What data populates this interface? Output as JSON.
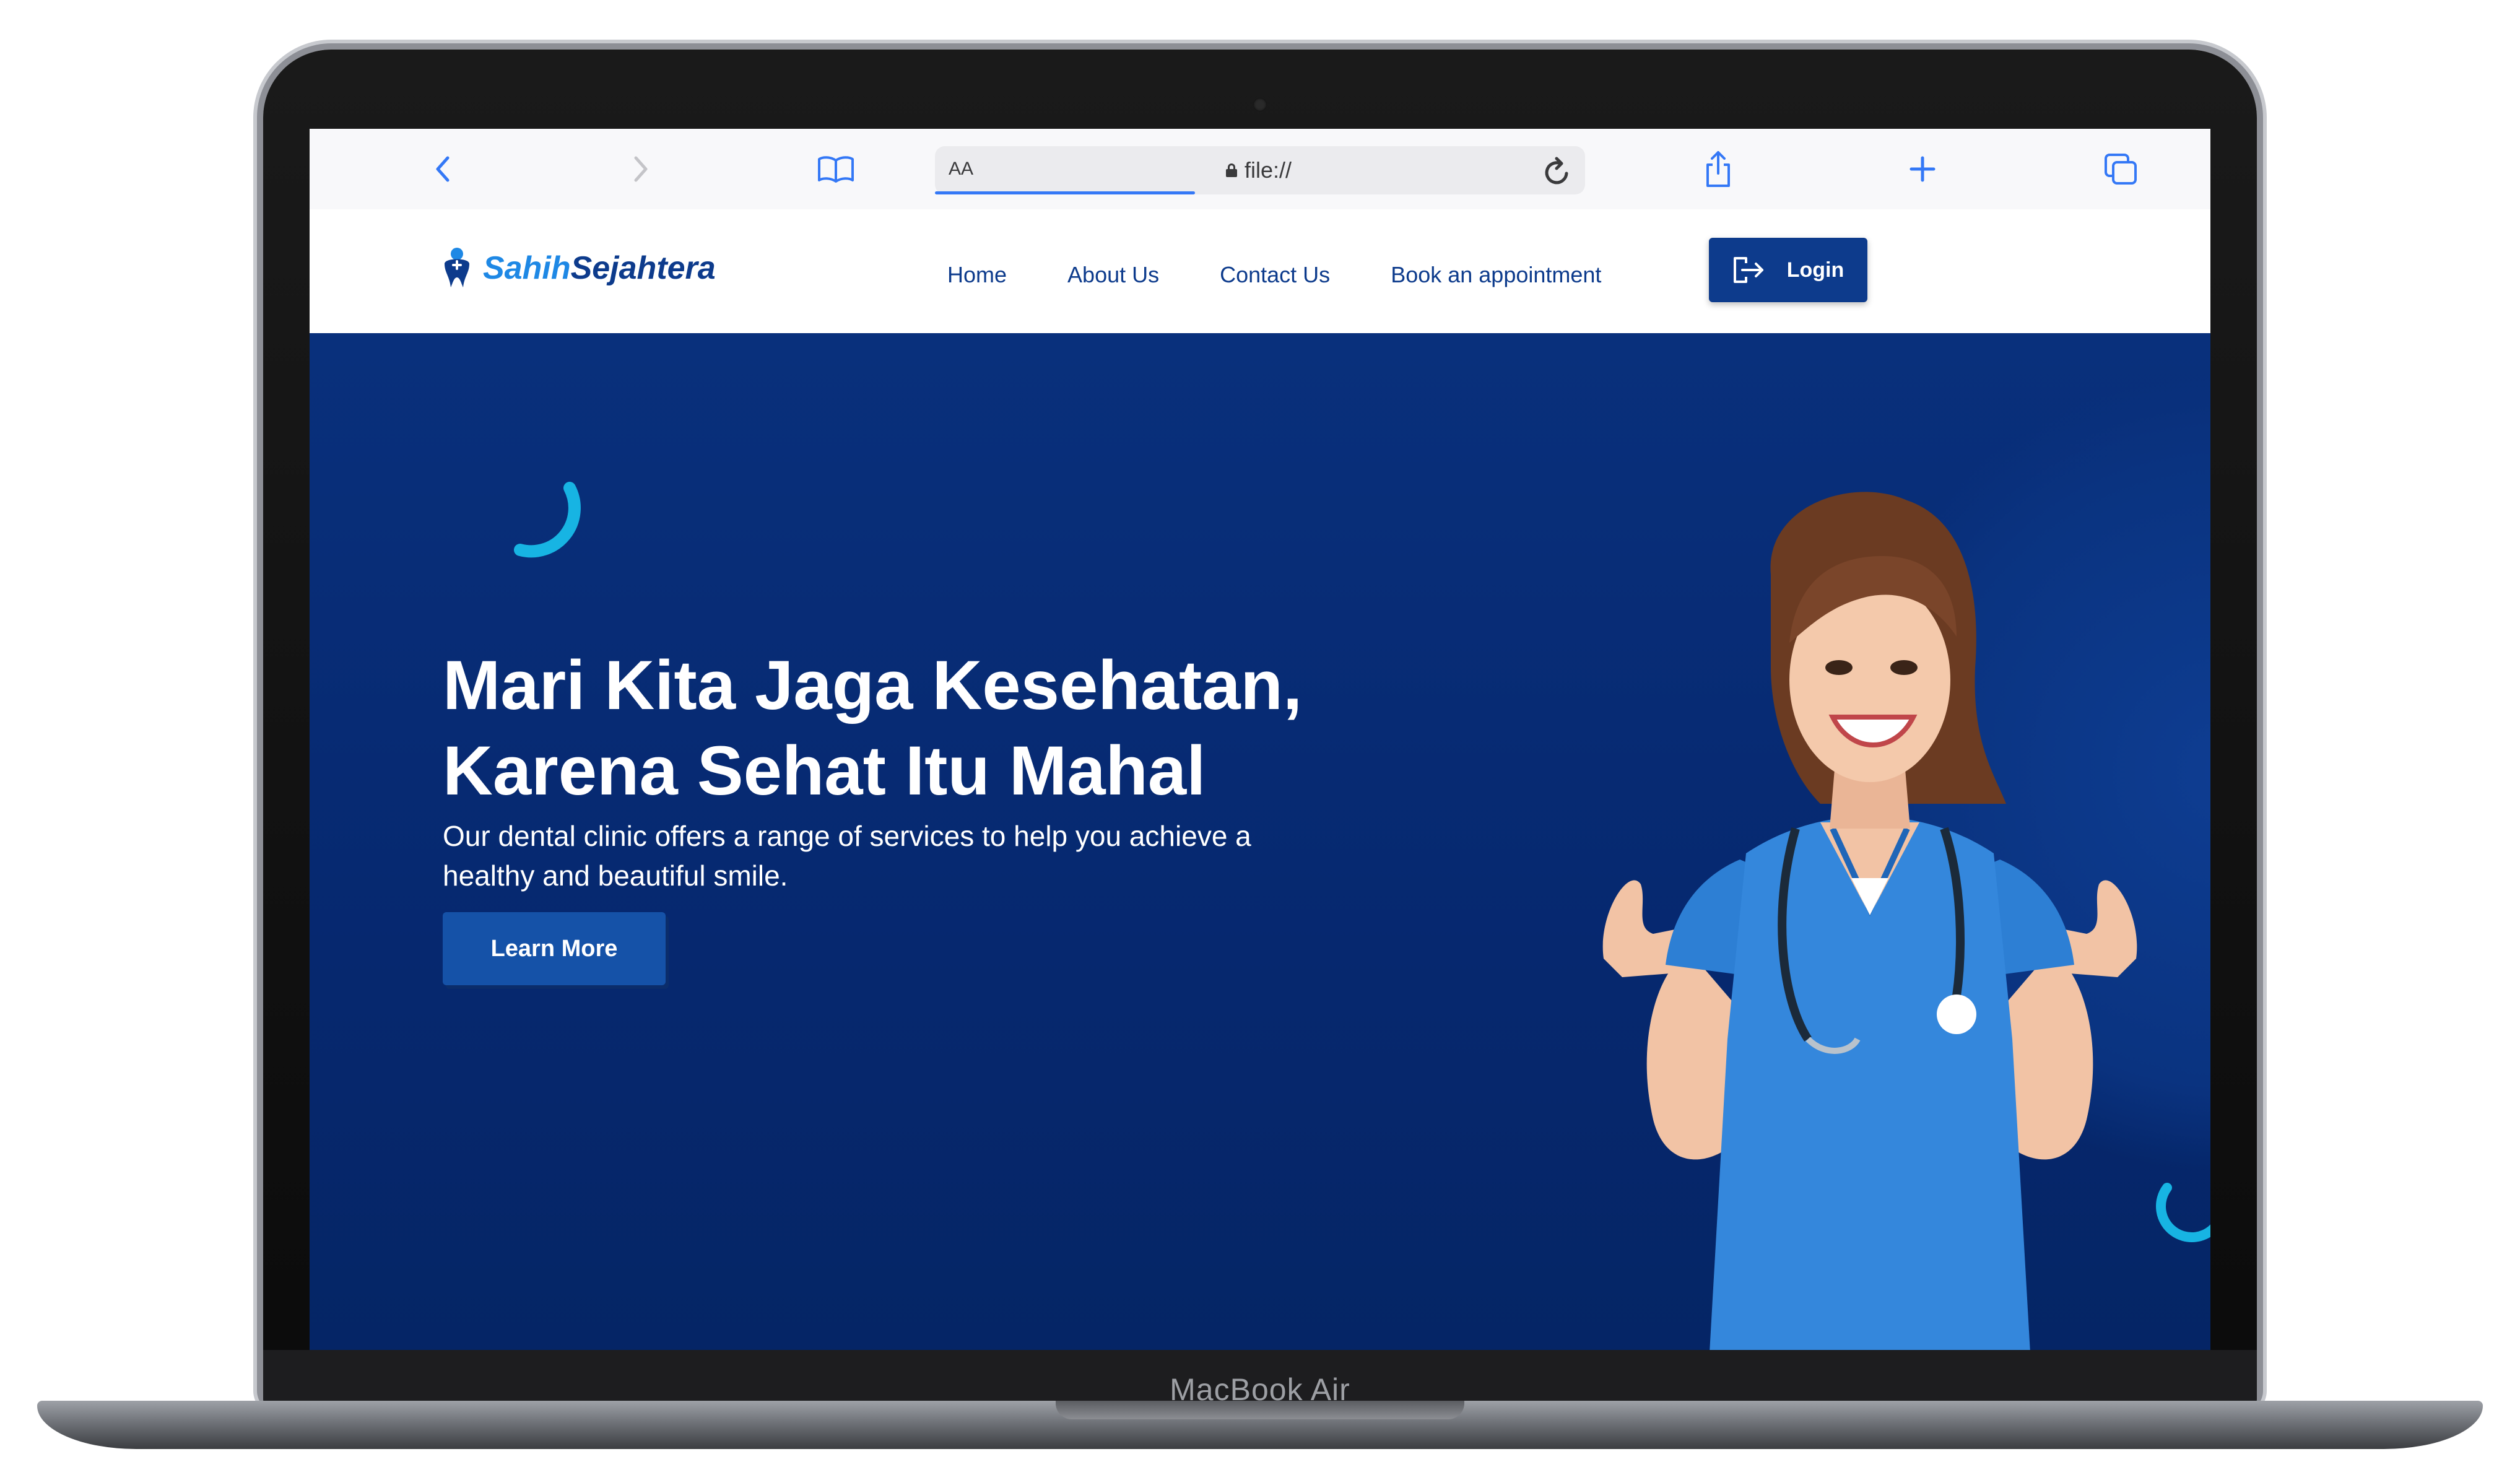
{
  "device": {
    "label": "MacBook Air"
  },
  "browser": {
    "text_size_label": "AA",
    "url": "file://"
  },
  "site": {
    "logo_part1": "Sahih",
    "logo_part2": "Sejahtera",
    "nav_links": [
      "Home",
      "About Us",
      "Contact Us",
      "Book an appointment"
    ],
    "login_label": "Login"
  },
  "hero": {
    "title_line1": "Mari Kita Jaga Kesehatan,",
    "title_line2": "Karena Sehat Itu Mahal",
    "subtitle_line1": "Our dental clinic offers a range of services to help you achieve a",
    "subtitle_line2": "healthy and beautiful smile.",
    "button_label": "Learn More"
  },
  "colors": {
    "brand_navy": "#0d3b8c",
    "brand_blue": "#1e88e5",
    "hero_bg": "#06286f",
    "accent_cyan": "#17b4e3",
    "safari_blue": "#3478f6"
  }
}
